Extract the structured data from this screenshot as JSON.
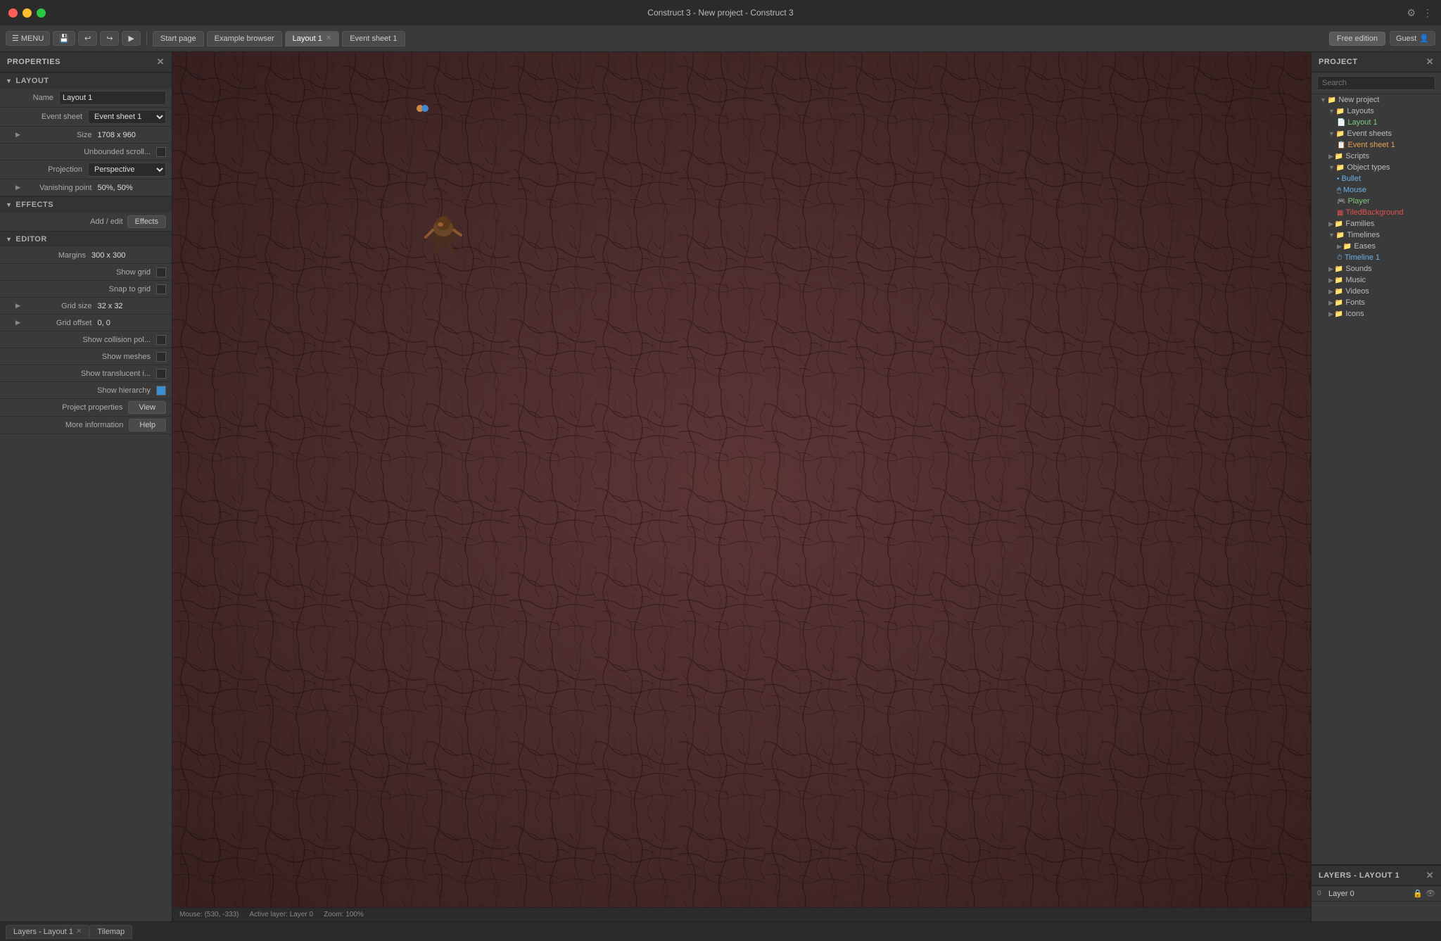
{
  "titlebar": {
    "title": "Construct 3 - New project - Construct 3",
    "traffic": [
      "red",
      "yellow",
      "green"
    ]
  },
  "toolbar": {
    "menu_label": "MENU",
    "tabs": [
      {
        "label": "Start page",
        "active": false,
        "closeable": false
      },
      {
        "label": "Example browser",
        "active": false,
        "closeable": false
      },
      {
        "label": "Layout 1",
        "active": true,
        "closeable": true
      },
      {
        "label": "Event sheet 1",
        "active": false,
        "closeable": false
      }
    ],
    "free_edition_label": "Free edition",
    "guest_label": "Guest"
  },
  "properties": {
    "panel_title": "PROPERTIES",
    "sections": {
      "layout": {
        "label": "LAYOUT",
        "name_label": "Name",
        "name_value": "Layout 1",
        "event_sheet_label": "Event sheet",
        "event_sheet_value": "Event sheet 1",
        "size_label": "Size",
        "size_value": "1708 x 960",
        "unbounded_scroll_label": "Unbounded scroll...",
        "projection_label": "Projection",
        "projection_value": "Perspective",
        "vanishing_point_label": "Vanishing point",
        "vanishing_point_value": "50%, 50%"
      },
      "effects": {
        "label": "EFFECTS",
        "add_edit_label": "Add / edit",
        "effects_btn_label": "Effects"
      },
      "editor": {
        "label": "EDITOR",
        "margins_label": "Margins",
        "margins_value": "300 x 300",
        "show_grid_label": "Show grid",
        "snap_to_grid_label": "Snap to grid",
        "grid_size_label": "Grid size",
        "grid_size_value": "32 x 32",
        "grid_offset_label": "Grid offset",
        "grid_offset_value": "0, 0",
        "show_collision_label": "Show collision pol...",
        "show_meshes_label": "Show meshes",
        "show_translucent_label": "Show translucent i...",
        "show_hierarchy_label": "Show hierarchy",
        "project_properties_label": "Project properties",
        "view_btn_label": "View",
        "more_info_label": "More information",
        "help_btn_label": "Help"
      }
    }
  },
  "project": {
    "panel_title": "PROJECT",
    "search_placeholder": "Search",
    "tree": [
      {
        "label": "New project",
        "level": 1,
        "type": "folder",
        "arrow": "▼"
      },
      {
        "label": "Layouts",
        "level": 2,
        "type": "folder",
        "arrow": "▼"
      },
      {
        "label": "Layout 1",
        "level": 3,
        "type": "layout",
        "color": "green"
      },
      {
        "label": "Event sheets",
        "level": 2,
        "type": "folder",
        "arrow": "▼"
      },
      {
        "label": "Event sheet 1",
        "level": 3,
        "type": "event",
        "color": "orange"
      },
      {
        "label": "Scripts",
        "level": 2,
        "type": "folder",
        "arrow": "▶"
      },
      {
        "label": "Object types",
        "level": 2,
        "type": "folder",
        "arrow": "▼"
      },
      {
        "label": "Bullet",
        "level": 3,
        "type": "object",
        "color": "blue"
      },
      {
        "label": "Mouse",
        "level": 3,
        "type": "object",
        "color": "blue"
      },
      {
        "label": "Player",
        "level": 3,
        "type": "object",
        "color": "green"
      },
      {
        "label": "TiledBackground",
        "level": 3,
        "type": "object",
        "color": "red"
      },
      {
        "label": "Families",
        "level": 2,
        "type": "folder",
        "arrow": "▶"
      },
      {
        "label": "Timelines",
        "level": 2,
        "type": "folder",
        "arrow": "▼"
      },
      {
        "label": "Eases",
        "level": 3,
        "type": "folder",
        "arrow": "▶"
      },
      {
        "label": "Timeline 1",
        "level": 3,
        "type": "timeline",
        "color": "blue"
      },
      {
        "label": "Sounds",
        "level": 2,
        "type": "folder",
        "arrow": "▶"
      },
      {
        "label": "Music",
        "level": 2,
        "type": "folder",
        "arrow": "▶"
      },
      {
        "label": "Videos",
        "level": 2,
        "type": "folder",
        "arrow": "▶"
      },
      {
        "label": "Fonts",
        "level": 2,
        "type": "folder",
        "arrow": "▶"
      },
      {
        "label": "Icons",
        "level": 2,
        "type": "folder",
        "arrow": "▶"
      }
    ]
  },
  "layers": {
    "panel_title": "LAYERS - LAYOUT 1",
    "items": [
      {
        "num": "0",
        "name": "Layer 0"
      }
    ]
  },
  "statusbar": {
    "mouse_label": "Mouse:",
    "mouse_value": "(530, -333)",
    "active_layer_label": "Active layer:",
    "active_layer_value": "Layer 0",
    "zoom_label": "Zoom:",
    "zoom_value": "100%"
  },
  "bottom_tabs": [
    {
      "label": "Layers - Layout 1",
      "closeable": true
    },
    {
      "label": "Tilemap",
      "closeable": false
    }
  ]
}
